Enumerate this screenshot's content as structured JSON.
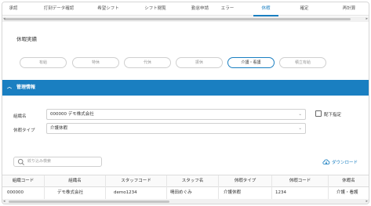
{
  "topnav": {
    "tabs": [
      {
        "label": "承認"
      },
      {
        "label": "打刻データ確認"
      },
      {
        "label": "希望シフト"
      },
      {
        "label": "シフト閲覧"
      },
      {
        "label": "勤怠申請"
      },
      {
        "label": "エラー"
      },
      {
        "label": "休暇",
        "active": true
      },
      {
        "label": "確定"
      },
      {
        "label": "再計算"
      }
    ]
  },
  "page": {
    "title": "休暇実績"
  },
  "filters": [
    {
      "label": "有給"
    },
    {
      "label": "特休"
    },
    {
      "label": "代休"
    },
    {
      "label": "振休"
    },
    {
      "label": "介護・看護",
      "active": true
    },
    {
      "label": "積立有給"
    }
  ],
  "section": {
    "title": "管理情報"
  },
  "form": {
    "org_label": "組織名",
    "org_value": "000000 デモ株式会社",
    "leave_type_label": "休暇タイプ",
    "leave_type_value": "介護休暇",
    "include_sub_label": "配下指定"
  },
  "search": {
    "placeholder": "絞り込み検索"
  },
  "download": {
    "label": "ダウンロード"
  },
  "table": {
    "headers": [
      "組織コード",
      "組織名",
      "スタッフコード",
      "スタッフ名",
      "休暇タイプ",
      "休暇コード",
      "休暇名"
    ],
    "rows": [
      [
        "000000",
        "デモ株式会社",
        "demo1234",
        "鳴田めぐみ",
        "介護休暇",
        "1234",
        "介護・看護"
      ]
    ]
  },
  "colors": {
    "accent": "#1a7fc1"
  }
}
